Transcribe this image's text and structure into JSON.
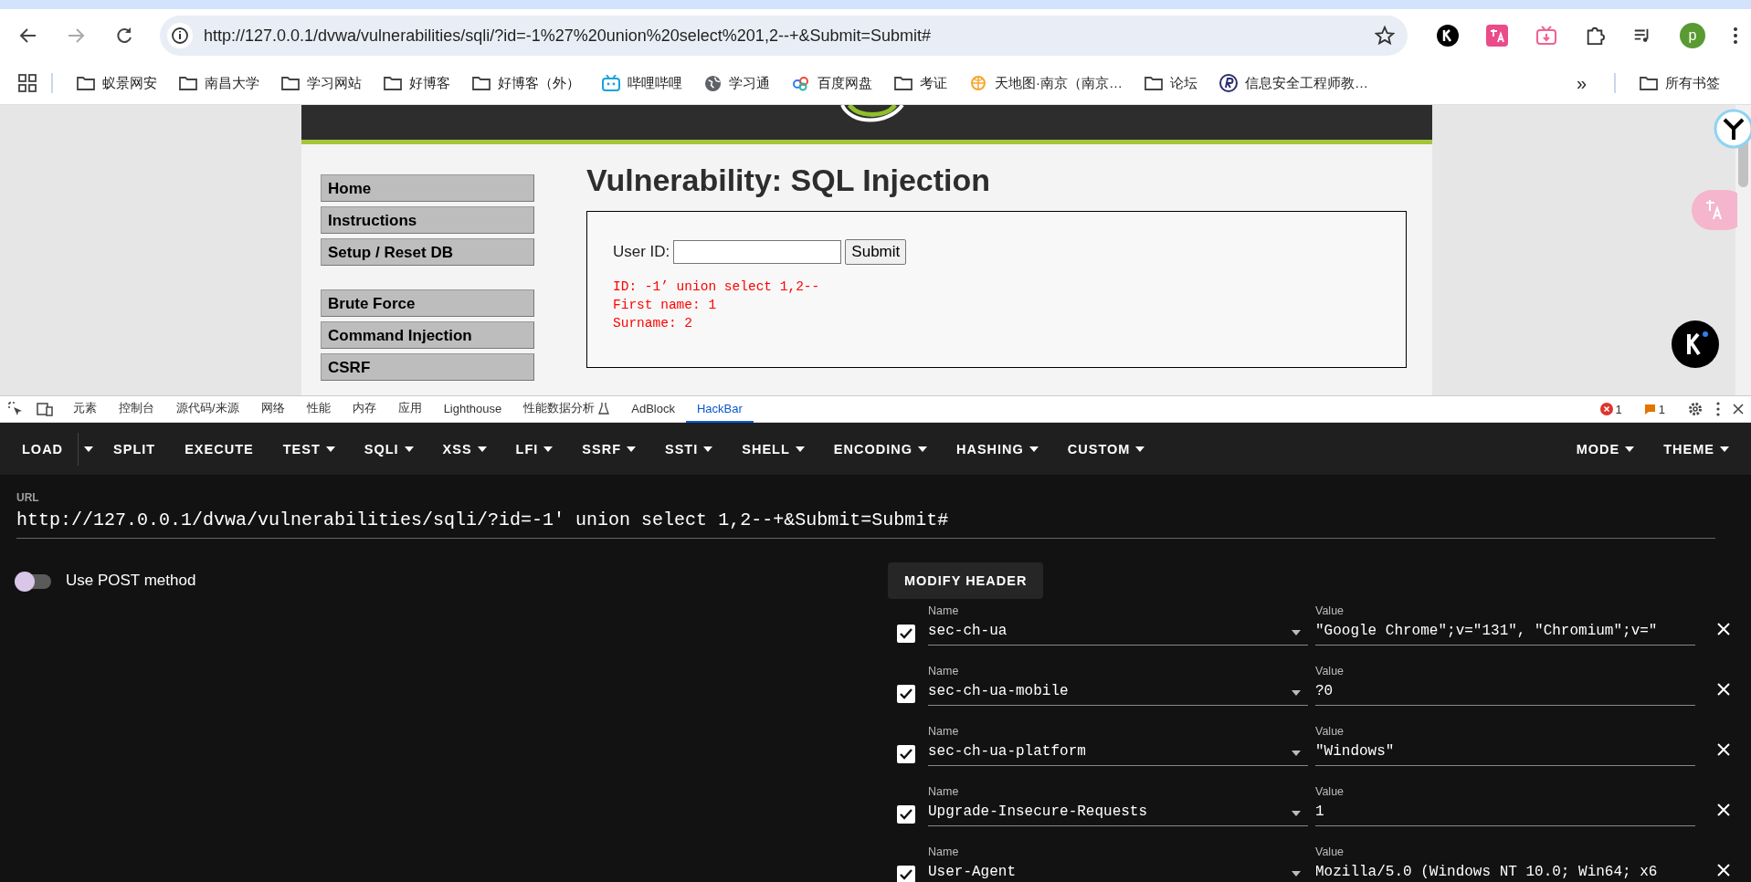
{
  "browser": {
    "address": "http://127.0.0.1/dvwa/vulnerabilities/sqli/?id=-1%27%20union%20select%201,2--+&Submit=Submit#",
    "profile": "p",
    "bookmarks": [
      {
        "kind": "folder",
        "label": "蚁景网安"
      },
      {
        "kind": "folder",
        "label": "南昌大学"
      },
      {
        "kind": "folder",
        "label": "学习网站"
      },
      {
        "kind": "folder",
        "label": "好博客"
      },
      {
        "kind": "folder",
        "label": "好博客（外）"
      },
      {
        "kind": "tv",
        "label": "哔哩哔哩"
      },
      {
        "kind": "globe",
        "label": "学习通"
      },
      {
        "kind": "cloud",
        "label": "百度网盘"
      },
      {
        "kind": "folder",
        "label": "考证"
      },
      {
        "kind": "sun",
        "label": "天地图·南京（南京…"
      },
      {
        "kind": "folder",
        "label": "论坛"
      },
      {
        "kind": "r",
        "label": "信息安全工程师教…"
      }
    ],
    "more": "»",
    "all_bookmarks": "所有书签"
  },
  "page": {
    "nav_groups": [
      [
        "Home",
        "Instructions",
        "Setup / Reset DB"
      ],
      [
        "Brute Force",
        "Command Injection",
        "CSRF"
      ]
    ],
    "title": "Vulnerability: SQL Injection",
    "form": {
      "label": "User ID:",
      "button": "Submit"
    },
    "output": [
      "ID: -1’ union select 1,2--",
      "First name: 1",
      "Surname: 2"
    ]
  },
  "devtools": {
    "tabs": [
      {
        "label": "元素",
        "selected": false
      },
      {
        "label": "控制台",
        "selected": false
      },
      {
        "label": "源代码/来源",
        "selected": false
      },
      {
        "label": "网络",
        "selected": false
      },
      {
        "label": "性能",
        "selected": false
      },
      {
        "label": "内存",
        "selected": false
      },
      {
        "label": "应用",
        "selected": false
      },
      {
        "label": "Lighthouse",
        "selected": false
      },
      {
        "label": "性能数据分析",
        "selected": false
      },
      {
        "label": "AdBlock",
        "selected": false
      },
      {
        "label": "HackBar",
        "selected": true
      }
    ],
    "errors": "1",
    "warnings": "1"
  },
  "hackbar": {
    "left": [
      {
        "label": "LOAD",
        "kind": "split"
      },
      {
        "label": "SPLIT",
        "kind": "plain"
      },
      {
        "label": "EXECUTE",
        "kind": "plain"
      },
      {
        "label": "TEST",
        "kind": "menu"
      },
      {
        "label": "SQLI",
        "kind": "menu"
      },
      {
        "label": "XSS",
        "kind": "menu"
      },
      {
        "label": "LFI",
        "kind": "menu"
      },
      {
        "label": "SSRF",
        "kind": "menu"
      },
      {
        "label": "SSTI",
        "kind": "menu"
      },
      {
        "label": "SHELL",
        "kind": "menu"
      },
      {
        "label": "ENCODING",
        "kind": "menu"
      },
      {
        "label": "HASHING",
        "kind": "menu"
      },
      {
        "label": "CUSTOM",
        "kind": "menu"
      }
    ],
    "right": [
      {
        "label": "MODE",
        "kind": "menu"
      },
      {
        "label": "THEME",
        "kind": "menu"
      }
    ],
    "url_label": "URL",
    "url": "http://127.0.0.1/dvwa/vulnerabilities/sqli/?id=-1' union select 1,2--+&Submit=Submit#",
    "post": {
      "label": "Use POST method",
      "on": false
    },
    "modify_header": "MODIFY HEADER",
    "headers": [
      {
        "checked": true,
        "name_label": "Name",
        "name": "sec-ch-ua",
        "value_label": "Value",
        "value": "\"Google Chrome\";v=\"131\", \"Chromium\";v=\""
      },
      {
        "checked": true,
        "name_label": "Name",
        "name": "sec-ch-ua-mobile",
        "value_label": "Value",
        "value": "?0"
      },
      {
        "checked": true,
        "name_label": "Name",
        "name": "sec-ch-ua-platform",
        "value_label": "Value",
        "value": "\"Windows\""
      },
      {
        "checked": true,
        "name_label": "Name",
        "name": "Upgrade-Insecure-Requests",
        "value_label": "Value",
        "value": "1"
      },
      {
        "checked": true,
        "name_label": "Name",
        "name": "User-Agent",
        "value_label": "Value",
        "value": "Mozilla/5.0 (Windows NT 10.0; Win64; x6"
      }
    ]
  }
}
